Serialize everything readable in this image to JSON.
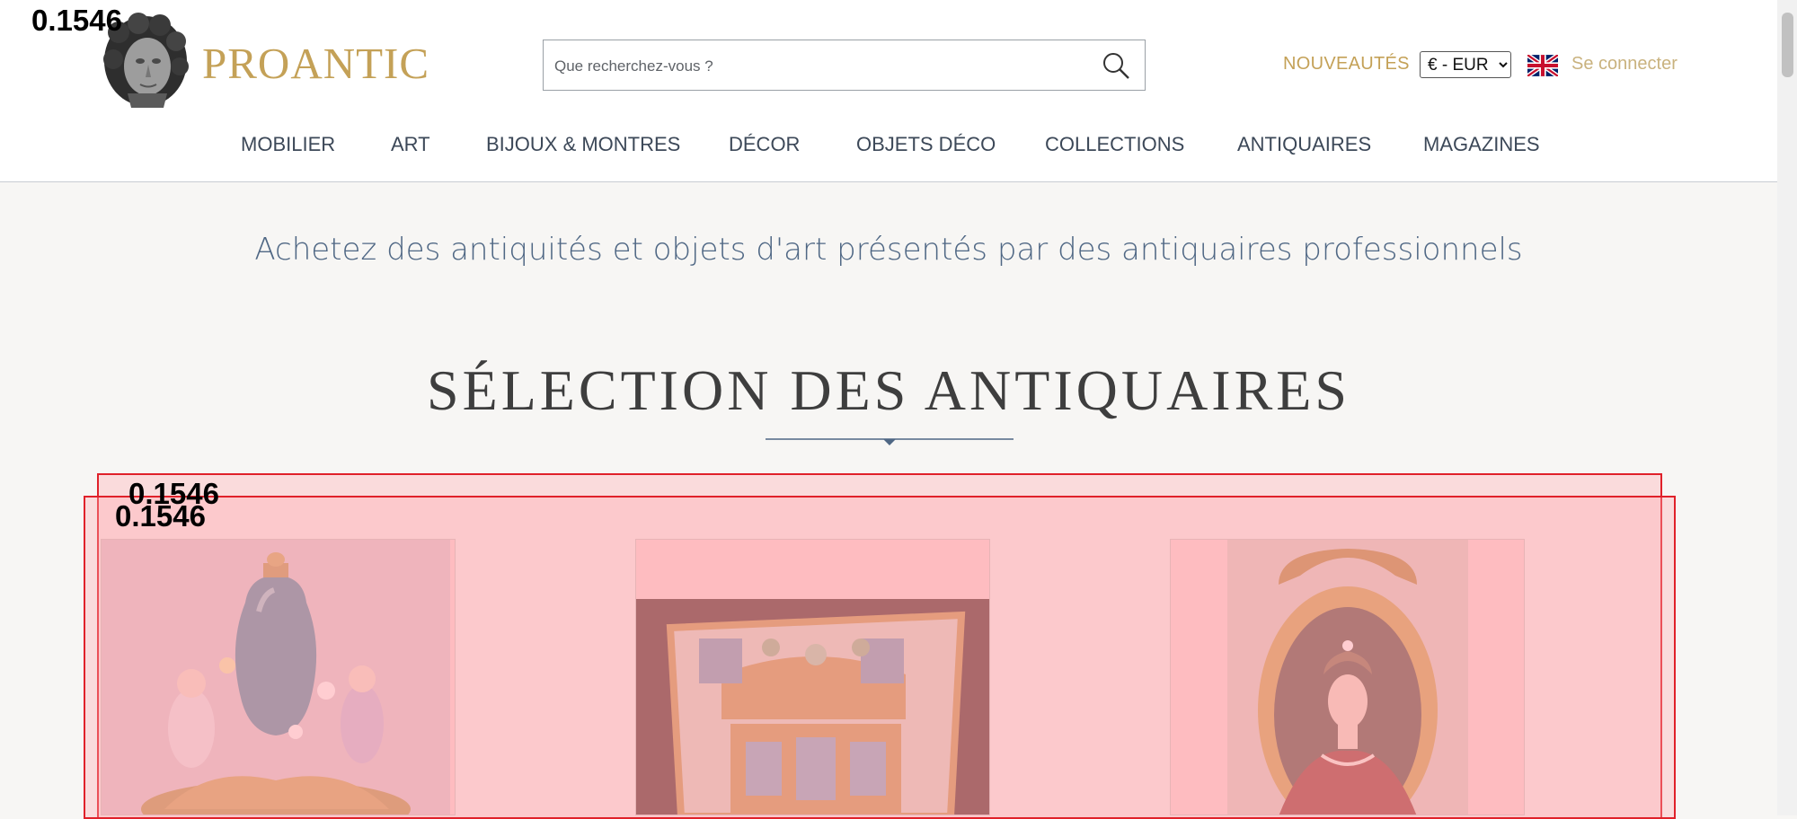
{
  "overlay_score": "0.1546",
  "header": {
    "brand": "PROANTIC",
    "search_placeholder": "Que recherchez-vous ?",
    "new_link": "NOUVEAUTÉS",
    "currency": "€ - EUR",
    "login": "Se connecter"
  },
  "nav": {
    "items": [
      "MOBILIER",
      "ART",
      "BIJOUX & MONTRES",
      "DÉCOR",
      "OBJETS DÉCO",
      "COLLECTIONS",
      "ANTIQUAIRES",
      "MAGAZINES"
    ]
  },
  "tagline": "Achetez des antiquités et objets d'art présentés par des antiquaires professionnels",
  "selection_title": "SÉLECTION DES ANTIQUAIRES",
  "colors": {
    "gold": "#c4a157",
    "navy": "#4f6784",
    "highlight_red": "#e0212a"
  }
}
